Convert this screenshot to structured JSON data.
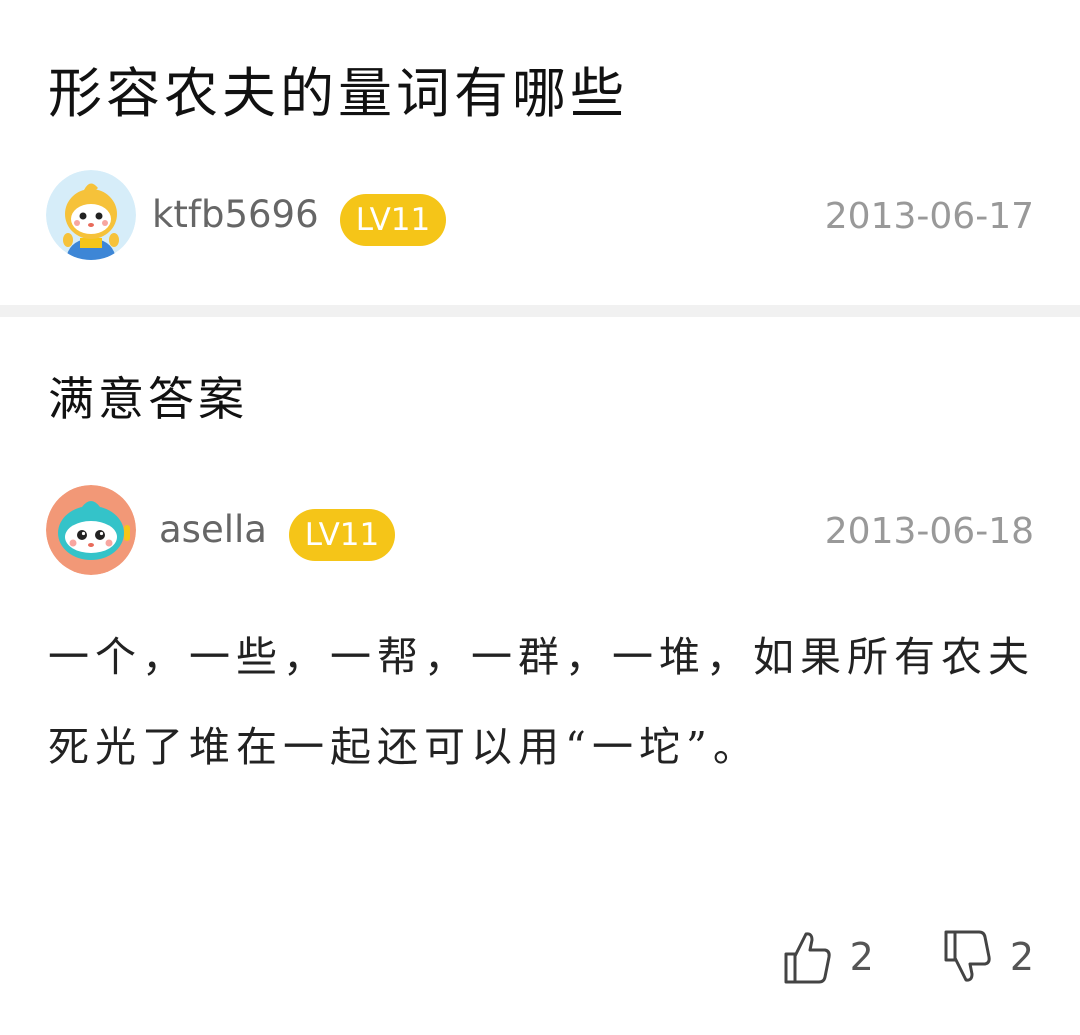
{
  "question": {
    "title": "形容农夫的量词有哪些",
    "author": {
      "username": "ktfb5696",
      "level": "LV11",
      "date": "2013-06-17",
      "avatar_icon": "yellow-cartoon-avatar-icon"
    }
  },
  "answer": {
    "section_title": "满意答案",
    "author": {
      "username": "asella",
      "level": "LV11",
      "date": "2013-06-18",
      "avatar_icon": "teal-cartoon-avatar-icon"
    },
    "text": "一个，一些，一帮，一群，一堆，如果所有农夫死光了堆在一起还可以用“一坨”。",
    "likes": "2",
    "dislikes": "2"
  },
  "colors": {
    "level_badge": "#f5c518",
    "divider": "#f1f1f1",
    "date": "#999999"
  }
}
